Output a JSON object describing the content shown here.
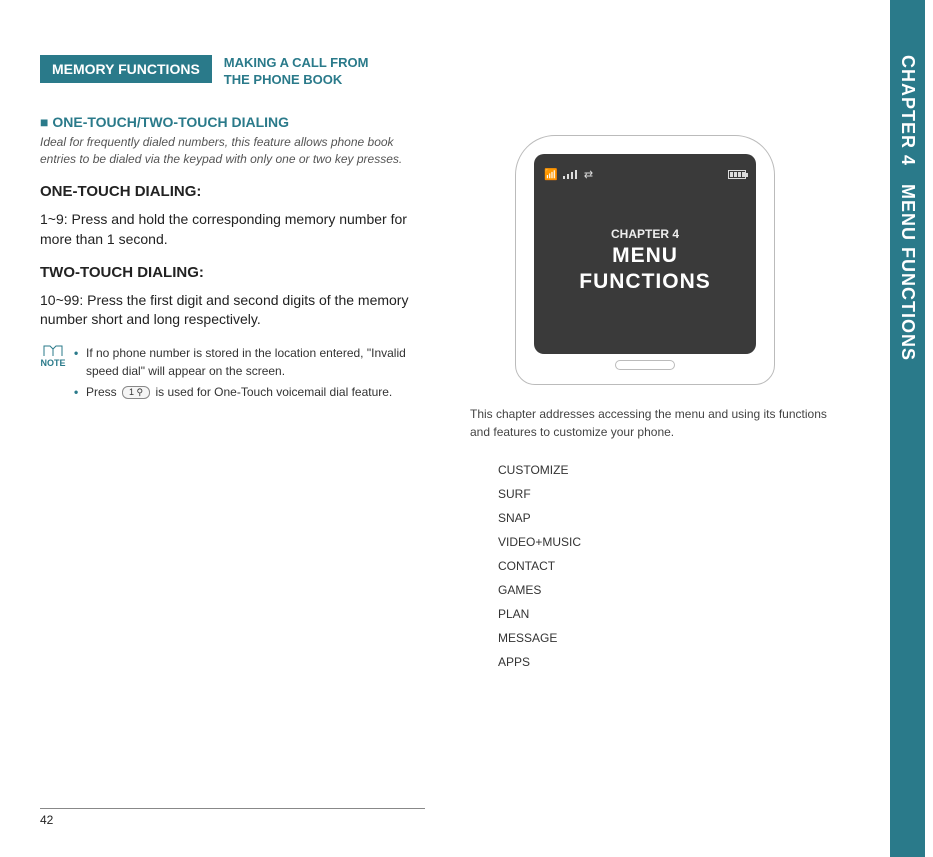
{
  "left": {
    "tab": "MEMORY FUNCTIONS",
    "header_line1": "MAKING A CALL FROM",
    "header_line2": "THE PHONE BOOK",
    "section_title": "ONE-TOUCH/TWO-TOUCH DIALING",
    "intro": "Ideal for frequently dialed numbers, this feature allows phone book entries to be dialed via the keypad with only one or two key presses.",
    "sub1": "ONE-TOUCH DIALING:",
    "step1": "1~9: Press and hold the corresponding memory number for more than 1 second.",
    "sub2": "TWO-TOUCH DIALING:",
    "step2": "10~99: Press the first digit and second digits of the memory number short and long respectively.",
    "note_label": "NOTE",
    "notes": [
      "If no phone number is stored in the location entered, \"Invalid speed dial\" will appear on the screen.",
      "Press       is used for One-Touch voicemail dial feature."
    ],
    "note2_pre": "Press",
    "note2_key": "1 ⚲",
    "note2_post": " is used for One-Touch voicemail dial feature.",
    "page_number": "42"
  },
  "right": {
    "screen_chapter": "CHAPTER 4",
    "screen_title1": "MENU",
    "screen_title2": "FUNCTIONS",
    "description": "This chapter addresses accessing the menu and using its functions and features to customize your phone.",
    "toc": [
      "CUSTOMIZE",
      "SURF",
      "SNAP",
      "VIDEO+MUSIC",
      "CONTACT",
      "GAMES",
      "PLAN",
      "MESSAGE",
      "APPS"
    ]
  },
  "side": {
    "chapter": "CHAPTER 4",
    "title": "MENU FUNCTIONS"
  }
}
